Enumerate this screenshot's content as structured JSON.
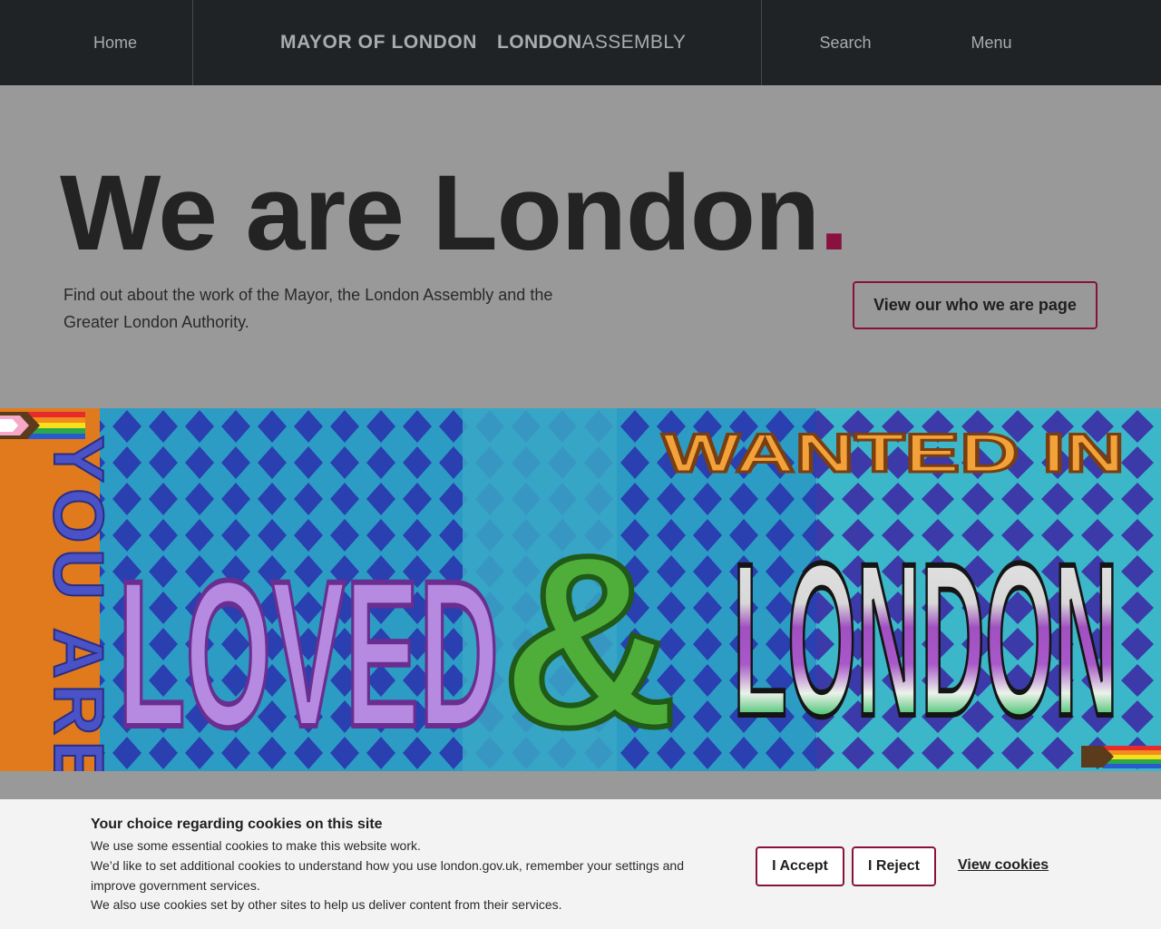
{
  "header": {
    "home_label": "Home",
    "logo_mayor": "MAYOR OF LONDON",
    "logo_assembly_bold": "LONDON",
    "logo_assembly_light": "ASSEMBLY",
    "search_label": "Search",
    "menu_label": "Menu"
  },
  "hero": {
    "title": "We are London",
    "title_dot": ".",
    "description": "Find out about the work of the Mayor, the London Assembly and the Greater London Authority.",
    "cta_label": "View our who we are page"
  },
  "mural": {
    "text_left": "YOU ARE",
    "text_main": "LOVED",
    "text_amp": "&",
    "text_wanted": "WANTED IN",
    "text_london": "LONDON"
  },
  "cookie": {
    "title": "Your choice regarding cookies on this site",
    "line1": "We use some essential cookies to make this website work.",
    "line2": "We’d like to set additional cookies to understand how you use london.gov.uk, remember your settings and improve government services.",
    "line3": "We also use cookies set by other sites to help us deliver content from their services.",
    "accept_label": "I Accept",
    "reject_label": "I Reject",
    "view_label": "View cookies"
  },
  "colors": {
    "header_bg": "#202326",
    "page_bg": "#999999",
    "accent": "#8a1040",
    "cookie_bg": "#f3f3f3"
  }
}
